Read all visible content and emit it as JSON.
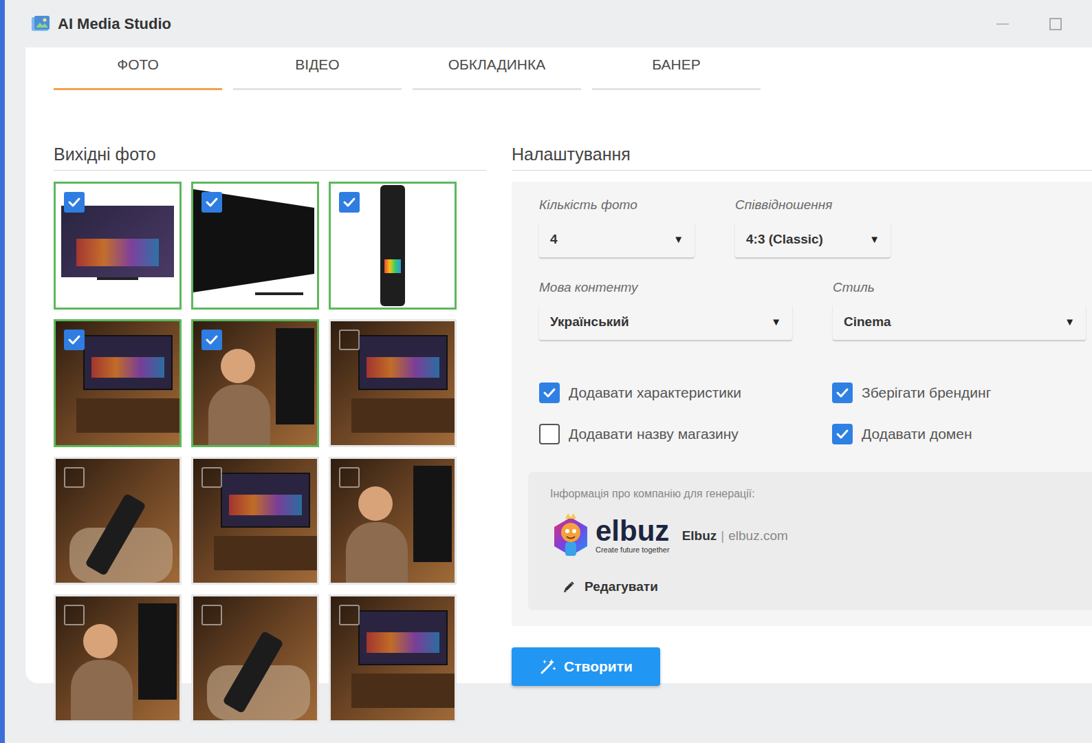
{
  "window": {
    "title": "AI Media Studio"
  },
  "tabs": [
    {
      "label": "ФОТО",
      "selected": true
    },
    {
      "label": "ВІДЕО",
      "selected": false
    },
    {
      "label": "ОБКЛАДИНКА",
      "selected": false
    },
    {
      "label": "БАНЕР",
      "selected": false
    }
  ],
  "source_photos": {
    "title": "Вихідні фото",
    "items": [
      {
        "kind": "tv-front",
        "checked": true
      },
      {
        "kind": "tv-angle",
        "checked": true
      },
      {
        "kind": "remote",
        "checked": true
      },
      {
        "kind": "scene-tv",
        "checked": true
      },
      {
        "kind": "scene-person",
        "checked": true
      },
      {
        "kind": "scene-tv",
        "checked": false
      },
      {
        "kind": "scene-remote",
        "checked": false
      },
      {
        "kind": "scene-tv",
        "checked": false
      },
      {
        "kind": "scene-person",
        "checked": false
      },
      {
        "kind": "scene-person",
        "checked": false
      },
      {
        "kind": "scene-remote",
        "checked": false
      },
      {
        "kind": "scene-tv",
        "checked": false
      }
    ]
  },
  "settings": {
    "title": "Налаштування",
    "fields": [
      {
        "label": "Кількість фото",
        "value": "4",
        "arrow": "▼"
      },
      {
        "label": "Співвідношення",
        "value": "4:3 (Classic)",
        "arrow": "▼"
      },
      {
        "label": "Мова контенту",
        "value": "Український",
        "arrow": "▼"
      },
      {
        "label": "Стиль",
        "value": "Cinema",
        "arrow": "▼"
      }
    ],
    "options": [
      {
        "label": "Додавати характеристики",
        "checked": true
      },
      {
        "label": "Зберігати брендинг",
        "checked": true
      },
      {
        "label": "Додавати назву магазину",
        "checked": false
      },
      {
        "label": "Додавати домен",
        "checked": true
      }
    ]
  },
  "company": {
    "caption": "Інформація про компанію для генерації:",
    "logo_word": "elbuz",
    "logo_tagline": "Create future together",
    "name": "Elbuz",
    "separator": "|",
    "domain": "elbuz.com",
    "edit": "Редагувати"
  },
  "create_button": {
    "label": "Створити"
  }
}
